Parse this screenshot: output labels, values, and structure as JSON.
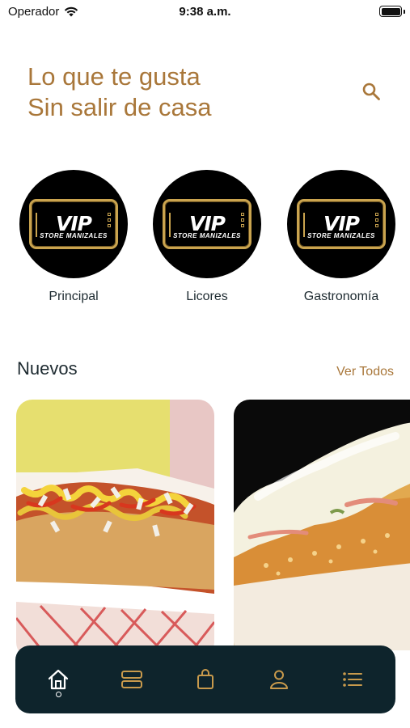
{
  "status_bar": {
    "carrier": "Operador",
    "time": "9:38 a.m."
  },
  "header": {
    "headline_line1": "Lo que te gusta",
    "headline_line2": "Sin salir de casa",
    "search_icon": "search-icon"
  },
  "brand_logo": {
    "main": "VIP",
    "sub": "STORE MANIZALES"
  },
  "categories": [
    {
      "label": "Principal"
    },
    {
      "label": "Licores"
    },
    {
      "label": "Gastronomía"
    }
  ],
  "section": {
    "title": "Nuevos",
    "see_all": "Ver Todos"
  },
  "products": [
    {
      "image": "hot-dog-with-sauces"
    },
    {
      "image": "hot-dog-with-cheese"
    }
  ],
  "bottom_nav": {
    "items": [
      {
        "icon": "home-icon",
        "active": true
      },
      {
        "icon": "catalog-icon",
        "active": false
      },
      {
        "icon": "shopping-bag-icon",
        "active": false
      },
      {
        "icon": "user-icon",
        "active": false
      },
      {
        "icon": "menu-list-icon",
        "active": false
      }
    ]
  },
  "colors": {
    "accent": "#a9773a",
    "nav_bg": "#0e242c",
    "text": "#1d2a30",
    "logo_gold": "#caa44f"
  }
}
